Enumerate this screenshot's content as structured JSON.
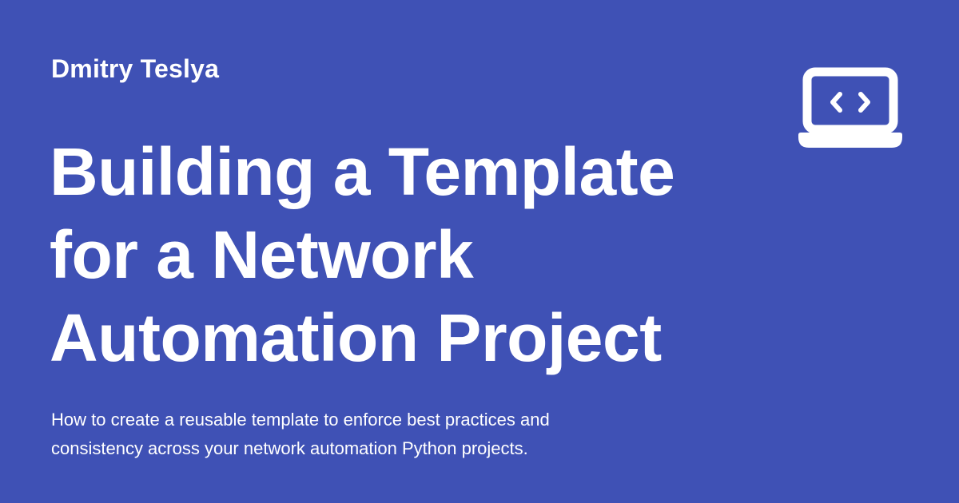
{
  "card": {
    "author": "Dmitry Teslya",
    "title_lines": [
      "Building a Template",
      "for a Network",
      "Automation Project"
    ],
    "description_lines": [
      "How to create a reusable template to enforce best practices and",
      "consistency across your network automation Python projects."
    ],
    "icon": "laptop-code-icon"
  },
  "colors": {
    "background": "#3f51b5",
    "text": "#ffffff"
  }
}
